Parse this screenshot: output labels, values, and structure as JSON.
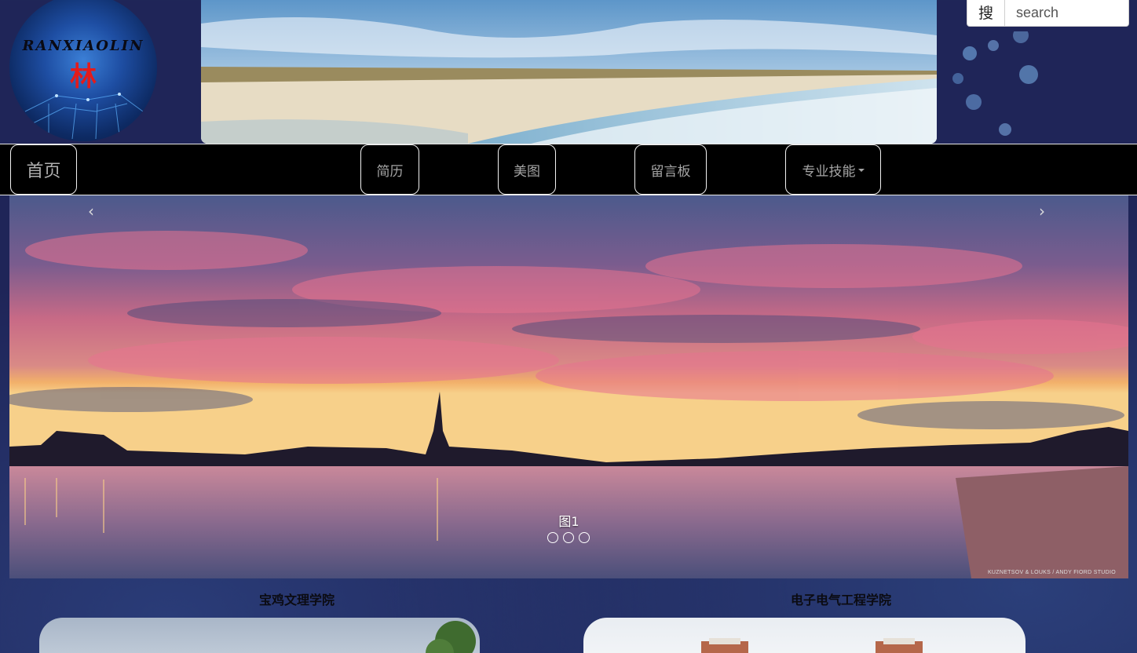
{
  "logo": {
    "text": "RANXIAOLIN",
    "char": "林"
  },
  "search": {
    "button_label": "搜",
    "placeholder": "search"
  },
  "nav": {
    "home": "首页",
    "resume": "简历",
    "photos": "美图",
    "message_board": "留言板",
    "skills": "专业技能"
  },
  "carousel": {
    "prev": "‹",
    "next": "›",
    "caption": "图1",
    "slide_count": 3,
    "active_index": 0,
    "credit": "KUZNETSOV & LOUKS / ANDY FIORD STUDIO"
  },
  "colleges": [
    {
      "title": "宝鸡文理学院"
    },
    {
      "title": "电子电气工程学院"
    }
  ],
  "colors": {
    "page_bg": "#1f2558",
    "nav_bg": "#000000",
    "nav_text": "#a5a5a5",
    "nav_border": "#f2f2f2"
  },
  "icons": {
    "search": "搜",
    "dropdown": "caret-down-icon"
  }
}
